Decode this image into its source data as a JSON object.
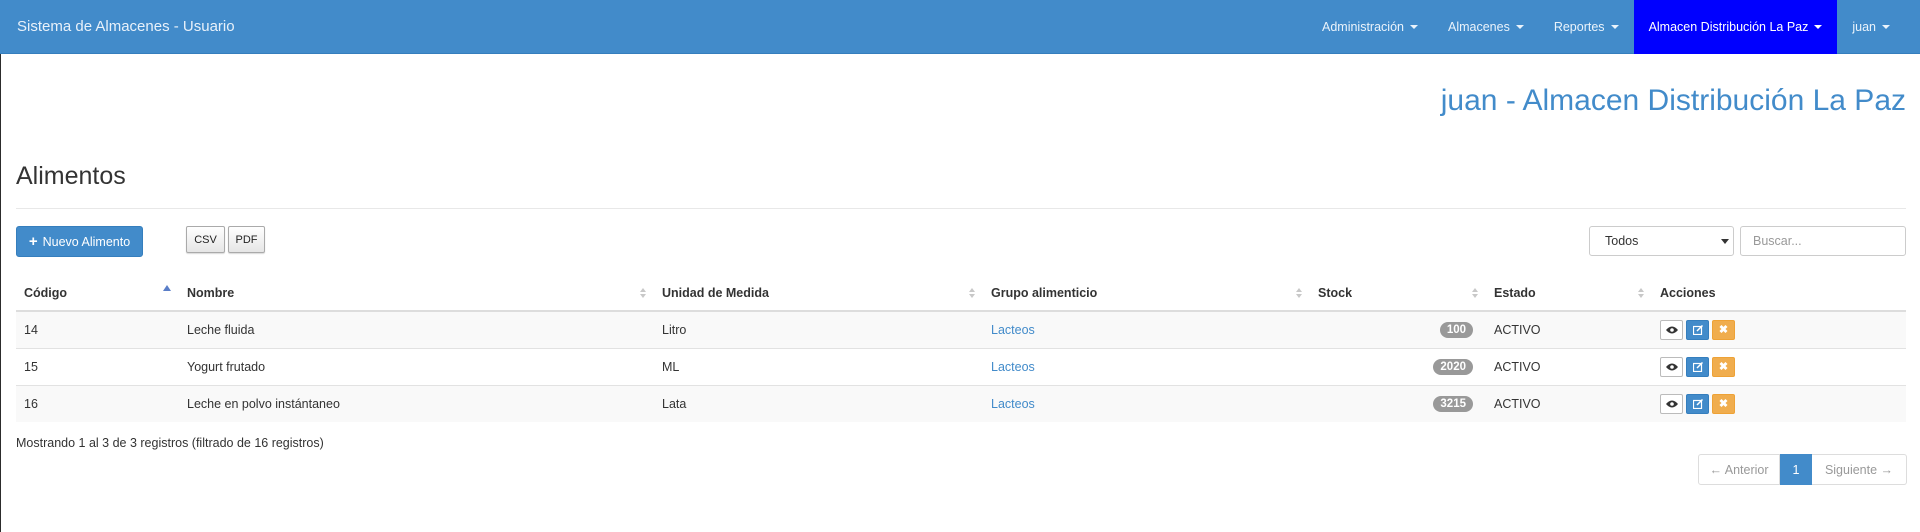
{
  "navbar": {
    "brand": "Sistema de Almacenes - Usuario",
    "items": [
      {
        "label": "Administración"
      },
      {
        "label": "Almacenes"
      },
      {
        "label": "Reportes"
      },
      {
        "label": "Almacen Distribución La Paz"
      },
      {
        "label": "juan"
      }
    ],
    "active_color": "#0000ff",
    "bar_color": "#428bca"
  },
  "header": {
    "user_heading": "juan - Almacen Distribución La Paz",
    "page_title": "Alimentos"
  },
  "toolbar": {
    "new_button": "Nuevo Alimento",
    "new_icon": "plus-icon",
    "csv_button": "CSV",
    "pdf_button": "PDF",
    "filter_select": "Todos",
    "search_placeholder": "Buscar..."
  },
  "table": {
    "columns": [
      "Código",
      "Nombre",
      "Unidad de Medida",
      "Grupo alimenticio",
      "Stock",
      "Estado",
      "Acciones"
    ],
    "sorted_column": "Código",
    "rows": [
      {
        "codigo": "14",
        "nombre": "Leche fluida",
        "unidad": "Litro",
        "grupo": "Lacteos",
        "stock": "100",
        "estado": "ACTIVO"
      },
      {
        "codigo": "15",
        "nombre": "Yogurt frutado",
        "unidad": "ML",
        "grupo": "Lacteos",
        "stock": "2020",
        "estado": "ACTIVO"
      },
      {
        "codigo": "16",
        "nombre": "Leche en polvo instántaneo",
        "unidad": "Lata",
        "grupo": "Lacteos",
        "stock": "3215",
        "estado": "ACTIVO"
      }
    ],
    "action_icons": [
      "eye-icon",
      "edit-icon",
      "delete-icon"
    ]
  },
  "info": "Mostrando 1 al 3 de 3 registros (filtrado de 16 registros)",
  "pagination": {
    "prev": "← Anterior",
    "current": "1",
    "next": "Siguiente →"
  }
}
